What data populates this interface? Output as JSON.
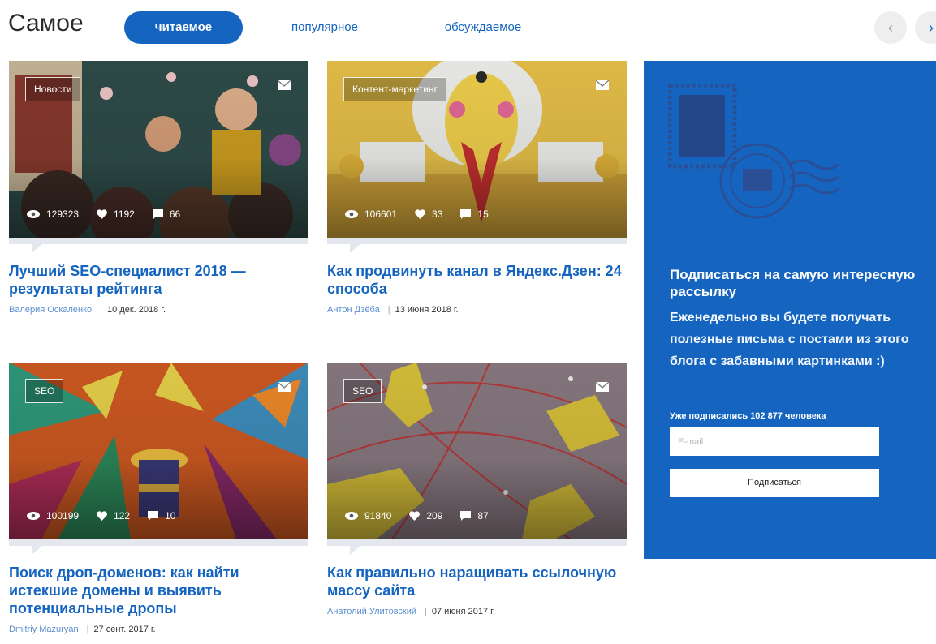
{
  "header": {
    "title": "Самое",
    "tabs": [
      {
        "label": "читаемое",
        "active": true
      },
      {
        "label": "популярное",
        "active": false
      },
      {
        "label": "обсуждаемое",
        "active": false
      }
    ],
    "prev_icon": "chevron-left-icon",
    "next_icon": "chevron-right-icon"
  },
  "articles": [
    {
      "category": "Новости",
      "views": "129323",
      "likes": "1192",
      "comments": "66",
      "title": "Лучший SEO-специалист 2018 — результаты рейтинга",
      "author": "Валерия Оскаленко",
      "date": "10 дек. 2018 г."
    },
    {
      "category": "Контент-маркетинг",
      "views": "106601",
      "likes": "33",
      "comments": "15",
      "title": "Как продвинуть канал в Яндекс.Дзен: 24 способа",
      "author": "Антон Дзёба",
      "date": "13 июня 2018 г."
    },
    {
      "category": "SEO",
      "views": "100199",
      "likes": "122",
      "comments": "10",
      "title": "Поиск дроп-доменов: как найти истекшие домены и выявить потенциальные дропы",
      "author": "Dmitriy Mazuryan",
      "date": "27 сент. 2017 г."
    },
    {
      "category": "SEO",
      "views": "91840",
      "likes": "209",
      "comments": "87",
      "title": "Как правильно наращивать ссылочную массу сайта",
      "author": "Анатолий Улитовский",
      "date": "07 июня 2017 г."
    }
  ],
  "subscribe": {
    "title": "Подписаться на самую интересную рассылку",
    "description": "Еженедельно вы будете получать полезные письма с постами из этого блога с забавными картинками :)",
    "count_text": "Уже подписались 102 877 человека",
    "email_placeholder": "E-mail",
    "button_label": "Подписаться"
  },
  "colors": {
    "accent": "#1565c0",
    "link": "#1565c0",
    "author": "#5b8fd0"
  }
}
